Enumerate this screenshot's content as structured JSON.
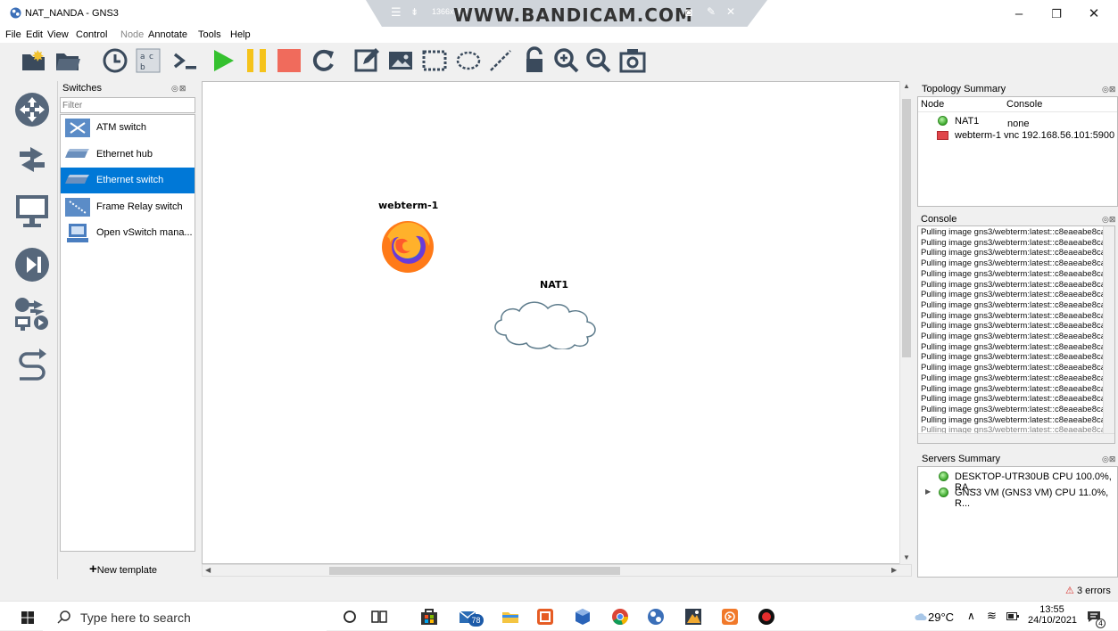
{
  "window": {
    "title": "NAT_NANDA - GNS3",
    "overlay_resolution": "1366x768",
    "overlay_logo": "WWW.BANDICAM.COM",
    "min_label": "–",
    "max_label": "❐",
    "close_label": "✕"
  },
  "menu": [
    "File",
    "Edit",
    "View",
    "Control",
    "Node",
    "Annotate",
    "Tools",
    "Help"
  ],
  "switches_panel": {
    "title": "Switches",
    "filter_placeholder": "Filter",
    "float_buttons": "◎⊠",
    "items": [
      {
        "label": "ATM switch"
      },
      {
        "label": "Ethernet hub"
      },
      {
        "label": "Ethernet switch"
      },
      {
        "label": "Frame Relay switch"
      },
      {
        "label": "Open vSwitch mana..."
      }
    ],
    "new_template": "New template"
  },
  "canvas": {
    "nodes": [
      {
        "label": "webterm-1"
      },
      {
        "label": "NAT1"
      }
    ]
  },
  "topology_summary": {
    "title": "Topology Summary",
    "col_node": "Node",
    "col_console": "Console",
    "rows": [
      {
        "node": "NAT1",
        "console": "none",
        "status": "green"
      },
      {
        "node": "webterm-1",
        "console": "vnc 192.168.56.101:5900",
        "status": "red"
      }
    ]
  },
  "console_panel": {
    "title": "Console",
    "line": "Pulling image gns3/webterm:latest::c8eaeabe8ca",
    "last_line": "Pulling image gns3/webterm:latest::c8eaeabe8ca"
  },
  "servers_summary": {
    "title": "Servers Summary",
    "servers": [
      {
        "label": "DESKTOP-UTR30UB CPU 100.0%, RA..."
      },
      {
        "label": "GNS3 VM (GNS3 VM) CPU 11.0%, R..."
      }
    ]
  },
  "status": {
    "errors": "3 errors"
  },
  "taskbar": {
    "search_placeholder": "Type here to search",
    "mail_badge": "78",
    "temperature": "29°C",
    "time": "13:55",
    "date": "24/10/2021",
    "notifications": "4"
  }
}
